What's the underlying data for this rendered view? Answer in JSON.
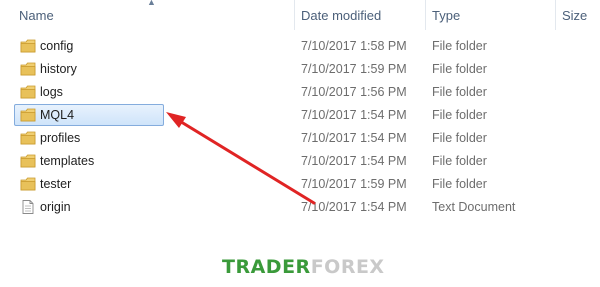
{
  "columns": {
    "name": "Name",
    "date_modified": "Date modified",
    "type": "Type",
    "size": "Size"
  },
  "files": [
    {
      "name": "config",
      "date": "7/10/2017 1:58 PM",
      "type": "File folder",
      "icon": "folder-icon"
    },
    {
      "name": "history",
      "date": "7/10/2017 1:59 PM",
      "type": "File folder",
      "icon": "folder-icon"
    },
    {
      "name": "logs",
      "date": "7/10/2017 1:56 PM",
      "type": "File folder",
      "icon": "folder-icon"
    },
    {
      "name": "MQL4",
      "date": "7/10/2017 1:54 PM",
      "type": "File folder",
      "icon": "folder-icon",
      "selected": true
    },
    {
      "name": "profiles",
      "date": "7/10/2017 1:54 PM",
      "type": "File folder",
      "icon": "folder-icon"
    },
    {
      "name": "templates",
      "date": "7/10/2017 1:54 PM",
      "type": "File folder",
      "icon": "folder-icon"
    },
    {
      "name": "tester",
      "date": "7/10/2017 1:59 PM",
      "type": "File folder",
      "icon": "folder-icon"
    },
    {
      "name": "origin",
      "date": "7/10/2017 1:54 PM",
      "type": "Text Document",
      "icon": "text-document-icon"
    }
  ],
  "watermark": {
    "part1": "TRADER",
    "part2": "FOREX"
  },
  "colors": {
    "arrow": "#e02424",
    "selection_border": "#84acdd",
    "folder": "#e8c15a",
    "watermark_green": "#3a9a3a"
  }
}
